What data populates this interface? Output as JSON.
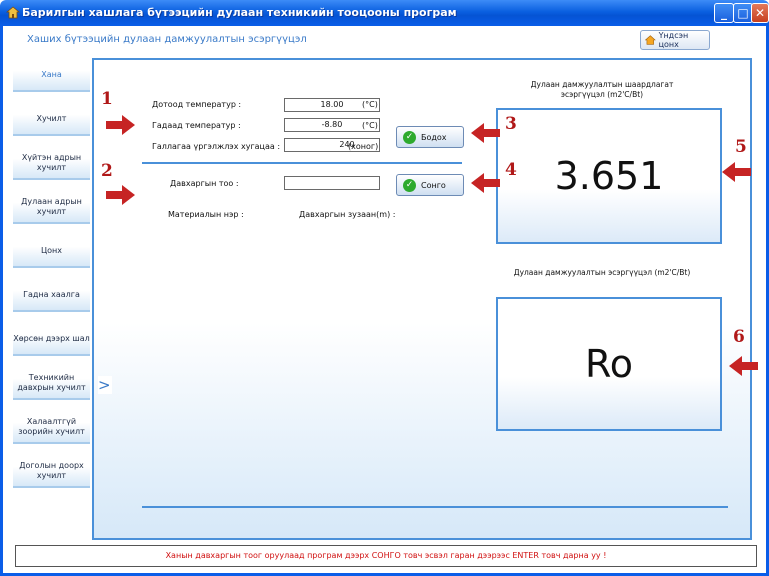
{
  "window": {
    "title": "Барилгын хашлага бүтээцийн дулаан техникийн тооцооны програм",
    "min_symbol": "_",
    "max_symbol": "□",
    "close_symbol": "✕"
  },
  "header": {
    "title": "Хаших бүтээцийн дулаан дамжуулалтын эсэргүүцэл",
    "home_button": "Үндсэн цонх"
  },
  "sidebar": {
    "items": [
      {
        "label": "Хана",
        "active": true
      },
      {
        "label": "Хучилт"
      },
      {
        "label": "Хүйтэн адрын хучилт"
      },
      {
        "label": "Дулаан адрын хучилт"
      },
      {
        "label": "Цонх"
      },
      {
        "label": "Гадна хаалга"
      },
      {
        "label": "Хөрсөн дээрх шал"
      },
      {
        "label": "Техникийн давхрын хучилт"
      },
      {
        "label": "Халаалтгүй зоорийн хучилт"
      },
      {
        "label": "Доголын доорх хучилт"
      }
    ],
    "toggle": ">"
  },
  "form": {
    "inner_temp": {
      "label": "Дотоод температур :",
      "value": "18.00",
      "unit": "(°C)"
    },
    "outer_temp": {
      "label": "Гадаад температур :",
      "value": "-8.80",
      "unit": "(°C)"
    },
    "heating_period": {
      "label": "Галлагаа үргэлжлэх хугацаа :",
      "value": "240",
      "unit": "(хоног)"
    },
    "calc_button": "Бодох",
    "layer_count": {
      "label": "Давхаргын тоо :",
      "value": ""
    },
    "choose_button": "Сонго",
    "material_name_label": "Материалын нэр :",
    "layer_thickness_label": "Давхаргын зузаан(m) :"
  },
  "results": {
    "required": {
      "title": "Дулаан дамжуулалтын шаардлагат эсэргүүцэл (m2'C/Bt)",
      "value": "3.651"
    },
    "actual": {
      "title": "Дулаан дамжуулалтын эсэргүүцэл (m2'C/Bt)",
      "value": "Ro"
    }
  },
  "markers": [
    "1",
    "2",
    "3",
    "4",
    "5",
    "6"
  ],
  "status": "Ханын давхаргын тоог оруулаад програм дээрх СОНГО товч эсвэл гаран дээрээс ENTER товч дарна уу !",
  "colors": {
    "accent": "#4a90d9",
    "marker": "#b01818",
    "titlebar": "#0a5de8",
    "status_text": "#d01010"
  }
}
